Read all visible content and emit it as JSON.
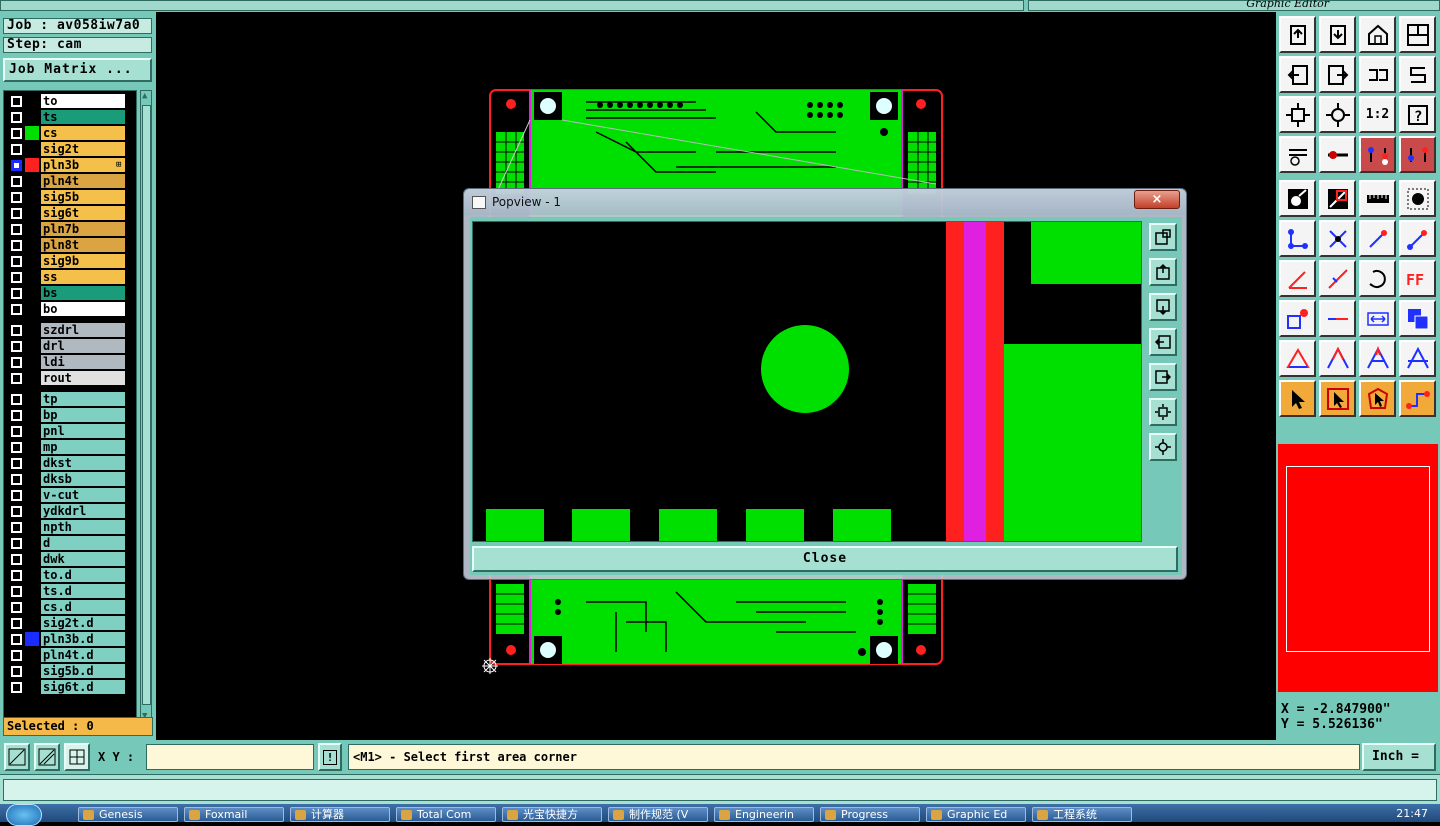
{
  "window": {
    "title_right": "Graphic Editor"
  },
  "job": {
    "label": "Job : av058iw7a0",
    "step": "Step: cam",
    "matrix_button": "Job Matrix ..."
  },
  "layers": [
    {
      "name": "to",
      "color": "#ffffff",
      "swatch": "#000000"
    },
    {
      "name": "ts",
      "color": "#1a9c7a",
      "swatch": "#000000"
    },
    {
      "name": "cs",
      "color": "#f5c04a",
      "swatch": "#00e000"
    },
    {
      "name": "sig2t",
      "color": "#f5c04a",
      "swatch": "#000000"
    },
    {
      "name": "pln3b",
      "color": "#f5c04a",
      "swatch": "#ff2020",
      "selected": true
    },
    {
      "name": "pln4t",
      "color": "#d9a441",
      "swatch": "#000000"
    },
    {
      "name": "sig5b",
      "color": "#f5c04a",
      "swatch": "#000000"
    },
    {
      "name": "sig6t",
      "color": "#f5c04a",
      "swatch": "#000000"
    },
    {
      "name": "pln7b",
      "color": "#d9a441",
      "swatch": "#000000"
    },
    {
      "name": "pln8t",
      "color": "#d9a441",
      "swatch": "#000000"
    },
    {
      "name": "sig9b",
      "color": "#f5c04a",
      "swatch": "#000000"
    },
    {
      "name": "ss",
      "color": "#f5c04a",
      "swatch": "#000000"
    },
    {
      "name": "bs",
      "color": "#1a9c7a",
      "swatch": "#000000"
    },
    {
      "name": "bo",
      "color": "#ffffff",
      "swatch": "#000000"
    },
    {
      "name": "szdrl",
      "color": "#b0b8c0",
      "swatch": "#000000"
    },
    {
      "name": "drl",
      "color": "#b0b8c0",
      "swatch": "#000000"
    },
    {
      "name": "ldi",
      "color": "#b0b8c0",
      "swatch": "#000000"
    },
    {
      "name": "rout",
      "color": "#e0e0e0",
      "swatch": "#000000"
    },
    {
      "name": "tp",
      "color": "#7fcfc2",
      "swatch": "#000000"
    },
    {
      "name": "bp",
      "color": "#7fcfc2",
      "swatch": "#000000"
    },
    {
      "name": "pnl",
      "color": "#7fcfc2",
      "swatch": "#000000"
    },
    {
      "name": "mp",
      "color": "#7fcfc2",
      "swatch": "#000000"
    },
    {
      "name": "dkst",
      "color": "#7fcfc2",
      "swatch": "#000000"
    },
    {
      "name": "dksb",
      "color": "#7fcfc2",
      "swatch": "#000000"
    },
    {
      "name": "v-cut",
      "color": "#7fcfc2",
      "swatch": "#000000"
    },
    {
      "name": "ydkdrl",
      "color": "#7fcfc2",
      "swatch": "#000000"
    },
    {
      "name": "npth",
      "color": "#7fcfc2",
      "swatch": "#000000"
    },
    {
      "name": "d",
      "color": "#7fcfc2",
      "swatch": "#000000"
    },
    {
      "name": "dwk",
      "color": "#7fcfc2",
      "swatch": "#000000"
    },
    {
      "name": "to.d",
      "color": "#7fcfc2",
      "swatch": "#000000"
    },
    {
      "name": "ts.d",
      "color": "#7fcfc2",
      "swatch": "#000000"
    },
    {
      "name": "cs.d",
      "color": "#7fcfc2",
      "swatch": "#000000"
    },
    {
      "name": "sig2t.d",
      "color": "#7fcfc2",
      "swatch": "#000000"
    },
    {
      "name": "pln3b.d",
      "color": "#7fcfc2",
      "swatch": "#1a2cff"
    },
    {
      "name": "pln4t.d",
      "color": "#7fcfc2",
      "swatch": "#000000"
    },
    {
      "name": "sig5b.d",
      "color": "#7fcfc2",
      "swatch": "#000000"
    },
    {
      "name": "sig6t.d",
      "color": "#7fcfc2",
      "swatch": "#000000"
    }
  ],
  "selected": "Selected : 0",
  "coords": {
    "x": "X = -2.847900\"",
    "y": "Y = 5.526136\""
  },
  "bottom": {
    "xy_label": "X Y :",
    "xy_value": "",
    "message": "<M1> - Select first area corner",
    "units": "Inch ="
  },
  "popview": {
    "title": "Popview - 1",
    "close_x": "×",
    "close_button": "Close"
  },
  "taskbar": {
    "items": [
      "Genesis",
      "Foxmail",
      "计算器",
      "Total Com",
      "光宝快捷方",
      "制作规范 (V",
      "Engineerin",
      "Progress",
      "Graphic Ed",
      "工程系统"
    ],
    "clock": "21:47"
  }
}
